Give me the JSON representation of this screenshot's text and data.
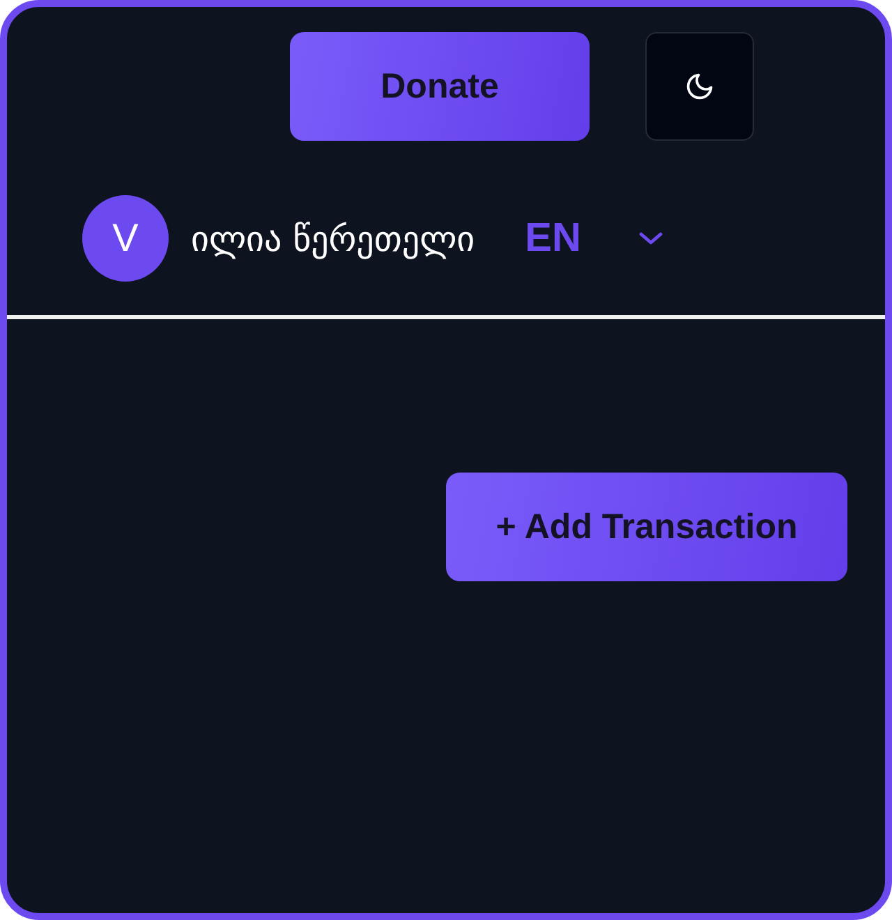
{
  "header": {
    "donate_button": "Donate",
    "user": {
      "avatar_initial": "V",
      "name": "ილია წერეთელი"
    },
    "language": "EN"
  },
  "main": {
    "add_button": "+ Add Transaction"
  }
}
